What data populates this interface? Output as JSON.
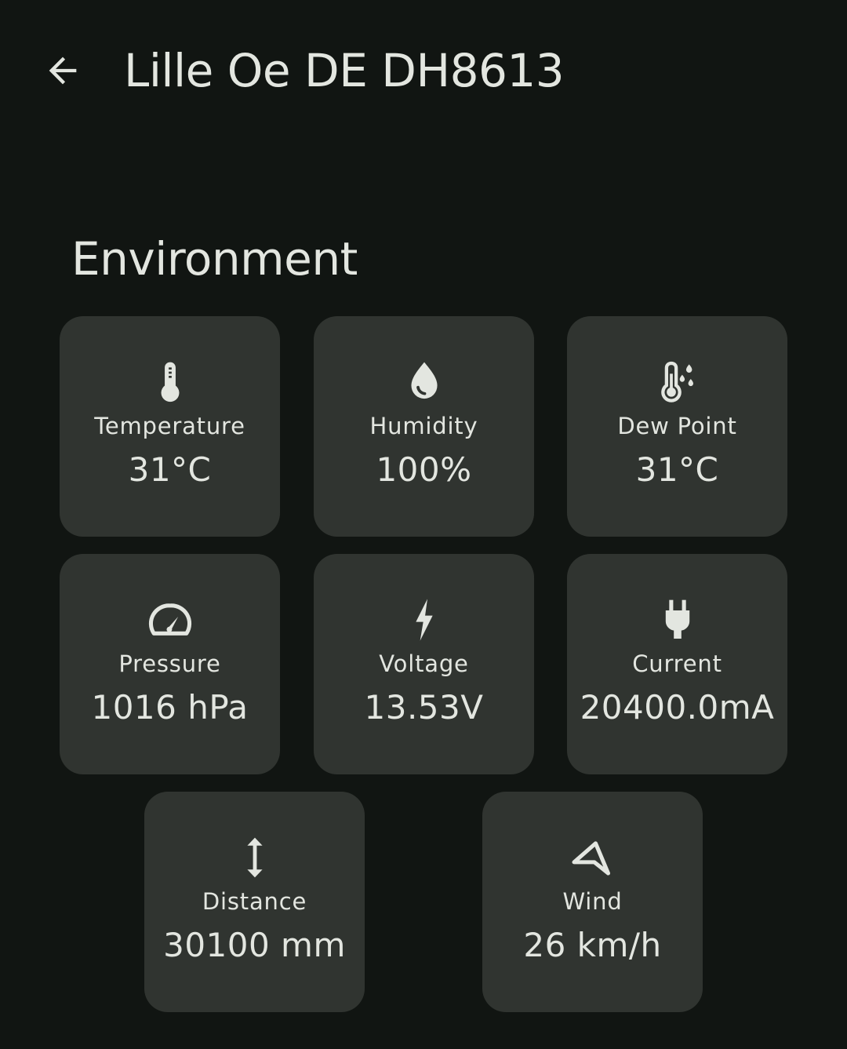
{
  "header": {
    "title": "Lille Oe DE DH8613"
  },
  "section": {
    "title": "Environment"
  },
  "tiles": {
    "temperature": {
      "label": "Temperature",
      "value": "31°C",
      "icon": "thermometer-icon"
    },
    "humidity": {
      "label": "Humidity",
      "value": "100%",
      "icon": "water-drop-icon"
    },
    "dew_point": {
      "label": "Dew Point",
      "value": "31°C",
      "icon": "dew-point-icon"
    },
    "pressure": {
      "label": "Pressure",
      "value": "1016 hPa",
      "icon": "speedometer-icon"
    },
    "voltage": {
      "label": "Voltage",
      "value": "13.53V",
      "icon": "bolt-icon"
    },
    "current": {
      "label": "Current",
      "value": "20400.0mA",
      "icon": "plug-icon"
    },
    "distance": {
      "label": "Distance",
      "value": "30100 mm",
      "icon": "vertical-arrows-icon"
    },
    "wind": {
      "label": "Wind",
      "value": "26 km/h",
      "icon": "navigation-arrow-icon"
    }
  },
  "colors": {
    "background": "#111512",
    "tile": "#303430",
    "text": "#e3e6e0"
  }
}
